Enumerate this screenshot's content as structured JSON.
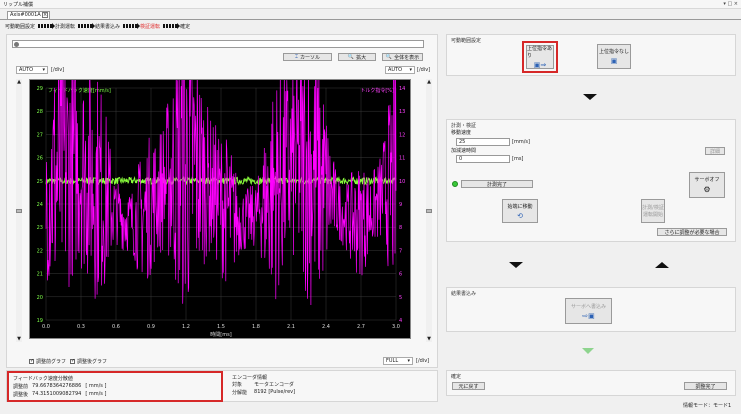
{
  "window": {
    "title": "リップル補償",
    "controls": "▾ □ ×"
  },
  "tab": {
    "label": "Axis#0001A",
    "close": "×"
  },
  "steps": [
    "可動範囲設定",
    "計測運転",
    "結果書込み",
    "検証運転",
    "確定"
  ],
  "chart_toolbar": {
    "cursor": "カーソル",
    "zoom": "拡大",
    "fit": "全体を表示"
  },
  "chart_controls": {
    "left_scale": "AUTO",
    "left_unit": "[/div]",
    "right_scale": "AUTO",
    "right_unit": "[/div]",
    "bottom_scale": "FULL",
    "bottom_unit": "[/div]"
  },
  "checkboxes": {
    "before": "調整前グラフ",
    "after": "調整後グラフ"
  },
  "chart_data": {
    "type": "line",
    "left_axis_title": "フィードバック速度[mm/s]",
    "right_axis_title": "トルク指令[%]",
    "xlabel": "時間[ms]",
    "x_ticks": [
      "0.0",
      "0.3",
      "0.6",
      "0.9",
      "1.2",
      "1.5",
      "1.8",
      "2.1",
      "2.4",
      "2.7",
      "3.0"
    ],
    "y_left_ticks": [
      "29",
      "28",
      "27",
      "26",
      "25",
      "24",
      "23",
      "22",
      "21",
      "20",
      "19"
    ],
    "y_right_ticks": [
      "14",
      "13",
      "12",
      "11",
      "10",
      "9",
      "8",
      "7",
      "6",
      "5",
      "4"
    ],
    "ylim_left": [
      19,
      29
    ],
    "ylim_right": [
      4,
      14
    ],
    "xlim": [
      0,
      3
    ],
    "series": [
      {
        "color": "#8aff3c",
        "axis": "left",
        "mean": 25,
        "noise": 0.15
      },
      {
        "color": "#ff00ff",
        "axis": "right",
        "mean": 9.5,
        "noise": 3.5
      }
    ]
  },
  "feedback_info": {
    "title": "フィードバック速度分散値",
    "rows": [
      {
        "label": "調整前",
        "value": "79.6678364276886",
        "unit": "[ mm/s ]"
      },
      {
        "label": "調整後",
        "value": "74.3151009082794",
        "unit": "[ mm/s ]"
      }
    ]
  },
  "encoder_info": {
    "title": "エンコーダ情報",
    "rows": [
      {
        "label": "対象",
        "value": "モータエンコーダ"
      },
      {
        "label": "分解能",
        "value": "8192 [Pulse/rev]"
      }
    ]
  },
  "right": {
    "range_section": {
      "title": "可動範囲設定",
      "with_cmd": "上位指令あり",
      "without_cmd": "上位指令なし"
    },
    "measure_section": {
      "title": "計測・検証",
      "speed_label": "移動速度",
      "speed_value": "25",
      "speed_unit": "[mm/s]",
      "accel_label": "加減速時間",
      "accel_value": "0",
      "accel_unit": "[ms]",
      "detail_button": "詳細",
      "status_button": "計測完了",
      "servo_off": "サーボオフ",
      "origin_move": "始端に移動",
      "measure_verify": "計測/検証\n運転開始",
      "more_adjust": "さらに調整が必要な場合"
    },
    "write_section": {
      "title": "結果書込み",
      "servo_write": "サーボへ書込み"
    },
    "confirm_section": {
      "title": "確定",
      "restore": "元に戻す",
      "finish": "調整完了"
    },
    "status_bar": "情報モード：モード1"
  }
}
